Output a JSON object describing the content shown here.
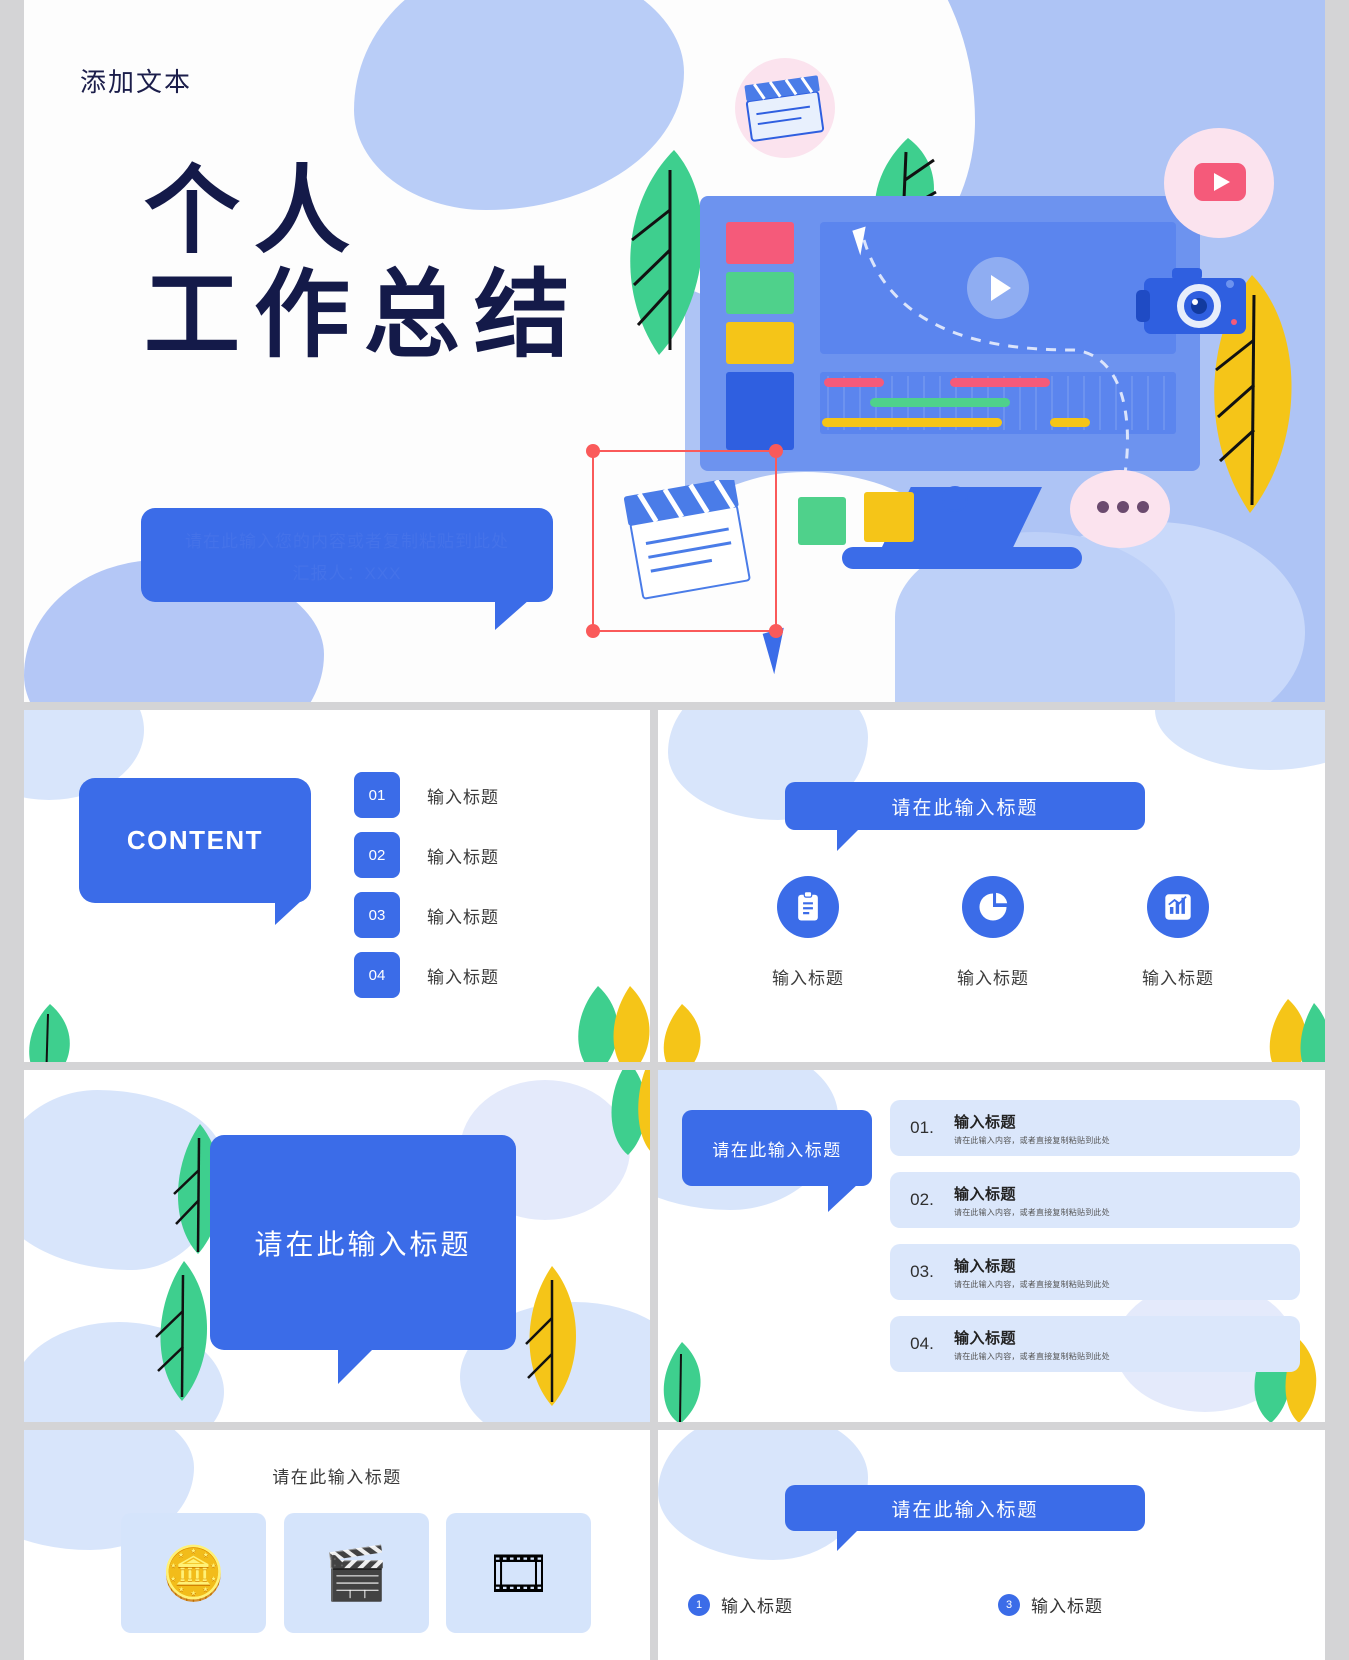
{
  "hero": {
    "eyebrow": "添加文本",
    "title_line1": "个人",
    "title_line2": "工作总结",
    "subtitle_faint_line1": "请在此输入您的内容或者复制粘贴到此处",
    "subtitle_faint_line2": "汇报人：XXX"
  },
  "slide_content": {
    "bubble_label": "CONTENT",
    "items": [
      {
        "num": "01",
        "label": "输入标题"
      },
      {
        "num": "02",
        "label": "输入标题"
      },
      {
        "num": "03",
        "label": "输入标题"
      },
      {
        "num": "04",
        "label": "输入标题"
      }
    ]
  },
  "slide_icons": {
    "heading": "请在此输入标题",
    "items": [
      {
        "icon": "clipboard-icon",
        "glyph": "📋",
        "label": "输入标题"
      },
      {
        "icon": "pie-chart-icon",
        "glyph": "◕",
        "label": "输入标题"
      },
      {
        "icon": "bar-chart-icon",
        "glyph": "📈",
        "label": "输入标题"
      }
    ]
  },
  "slide_section": {
    "heading": "请在此输入标题"
  },
  "slide_list": {
    "bubble_label": "请在此输入标题",
    "rows": [
      {
        "num": "01.",
        "title": "输入标题",
        "desc": "请在此输入内容，或者直接复制粘贴到此处"
      },
      {
        "num": "02.",
        "title": "输入标题",
        "desc": "请在此输入内容，或者直接复制粘贴到此处"
      },
      {
        "num": "03.",
        "title": "输入标题",
        "desc": "请在此输入内容，或者直接复制粘贴到此处"
      },
      {
        "num": "04.",
        "title": "输入标题",
        "desc": "请在此输入内容，或者直接复制粘贴到此处"
      }
    ]
  },
  "slide_cards": {
    "heading": "请在此输入标题",
    "cards": [
      {
        "icon": "coin-icon",
        "glyph": "🪙"
      },
      {
        "icon": "clapperboard-icon",
        "glyph": "🎬"
      },
      {
        "icon": "film-reel-icon",
        "glyph": "🎞"
      }
    ]
  },
  "slide_numbered": {
    "heading": "请在此输入标题",
    "items": [
      {
        "num": "1",
        "label": "输入标题"
      },
      {
        "num": "3",
        "label": "输入标题"
      }
    ]
  },
  "colors": {
    "accent_blue": "#3b6ce8",
    "light_blue": "#aec4f5",
    "pale_blue": "#dbe7fb",
    "navy": "#141a49",
    "red": "#fa5a5a",
    "green": "#3ecf8e",
    "yellow": "#f5c518",
    "gutter_gray": "#d4d4d6"
  }
}
